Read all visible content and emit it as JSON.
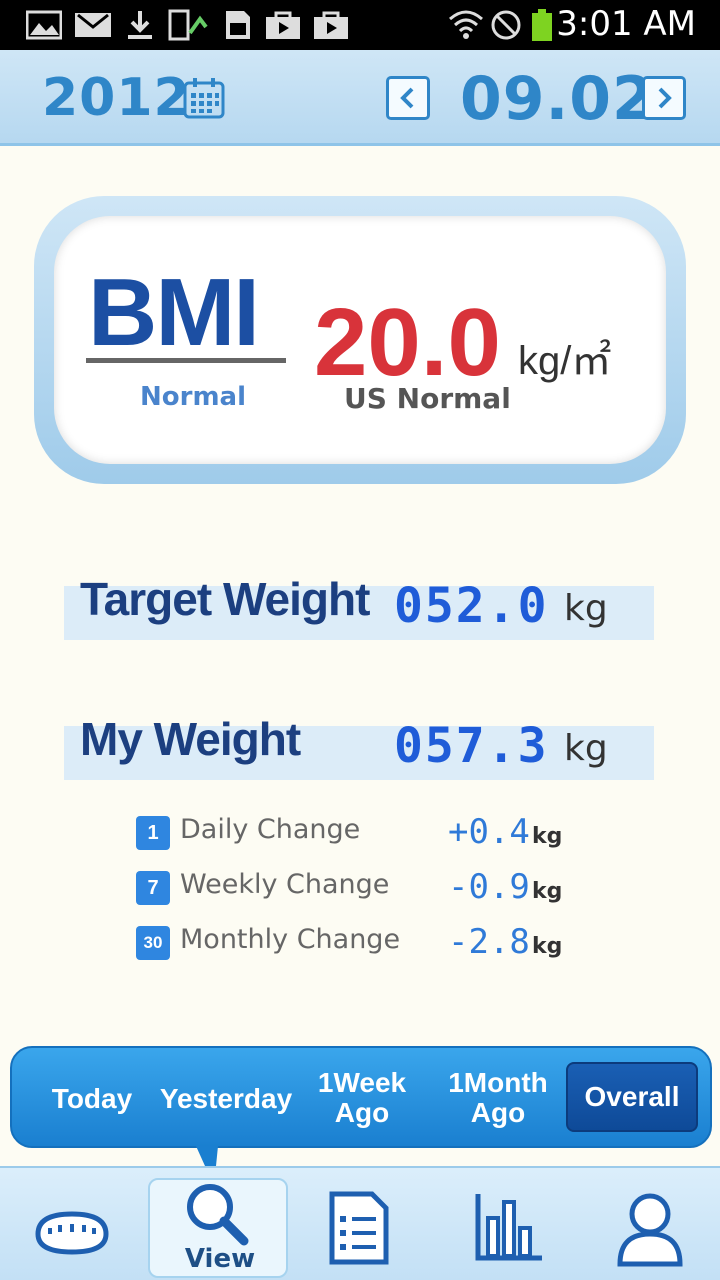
{
  "status_bar": {
    "time": "3:01 AM",
    "icons": [
      "image-icon",
      "gmail-icon",
      "download-icon",
      "phone-update-icon",
      "sd-card-icon",
      "play-store-icon",
      "play-store-icon",
      "wifi-icon",
      "do-not-disturb-icon",
      "battery-icon"
    ],
    "battery_color": "#7ed321"
  },
  "header": {
    "year": "2012",
    "date": "09.02"
  },
  "bmi": {
    "label": "BMI",
    "status": "Normal",
    "value": "20.0",
    "unit": "kg/㎡",
    "us_status": "US Normal"
  },
  "target_weight": {
    "label": "Target Weight",
    "value": "052.0",
    "unit": "kg"
  },
  "my_weight": {
    "label": "My Weight",
    "value": "057.3",
    "unit": "kg"
  },
  "changes": [
    {
      "icon": "1",
      "label": "Daily Change",
      "value": "+0.4",
      "unit": "kg"
    },
    {
      "icon": "7",
      "label": "Weekly Change",
      "value": "-0.9",
      "unit": "kg"
    },
    {
      "icon": "30",
      "label": "Monthly Change",
      "value": "-2.8",
      "unit": "kg"
    }
  ],
  "period_tabs": [
    {
      "line1": "Today",
      "line2": ""
    },
    {
      "line1": "Yesterday",
      "line2": ""
    },
    {
      "line1": "1Week",
      "line2": "Ago"
    },
    {
      "line1": "1Month",
      "line2": "Ago"
    },
    {
      "line1": "Overall",
      "line2": ""
    }
  ],
  "active_period": "Overall",
  "bottom_nav": {
    "active_label": "View"
  },
  "colors": {
    "accent": "#2f86c8",
    "bmi_value": "#d8333a",
    "weight_value": "#1f5cd8"
  }
}
